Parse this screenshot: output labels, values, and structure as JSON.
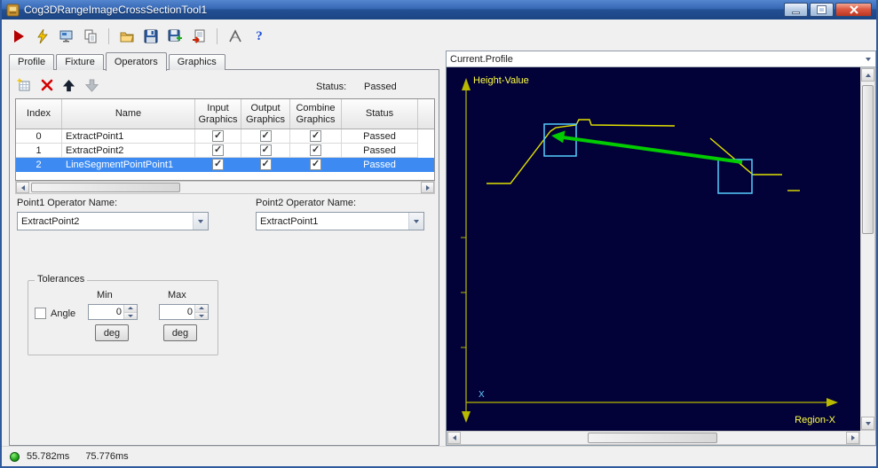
{
  "window": {
    "title": "Cog3DRangeImageCrossSectionTool1"
  },
  "tabs": [
    {
      "label": "Profile"
    },
    {
      "label": "Fixture"
    },
    {
      "label": "Operators"
    },
    {
      "label": "Graphics"
    }
  ],
  "operators": {
    "status_label": "Status:",
    "status_value": "Passed",
    "table": {
      "columns": [
        "Index",
        "Name",
        "Input Graphics",
        "Output Graphics",
        "Combine Graphics",
        "Status"
      ],
      "rows": [
        {
          "index": "0",
          "name": "ExtractPoint1",
          "input_graphics": true,
          "output_graphics": true,
          "combine_graphics": true,
          "status": "Passed",
          "selected": false
        },
        {
          "index": "1",
          "name": "ExtractPoint2",
          "input_graphics": true,
          "output_graphics": true,
          "combine_graphics": true,
          "status": "Passed",
          "selected": false
        },
        {
          "index": "2",
          "name": "LineSegmentPointPoint1",
          "input_graphics": true,
          "output_graphics": true,
          "combine_graphics": true,
          "status": "Passed",
          "selected": true
        }
      ]
    },
    "point1_label": "Point1 Operator Name:",
    "point1_value": "ExtractPoint2",
    "point2_label": "Point2 Operator Name:",
    "point2_value": "ExtractPoint1",
    "tolerances": {
      "group_label": "Tolerances",
      "min_label": "Min",
      "max_label": "Max",
      "angle_label": "Angle",
      "angle_checked": false,
      "min_value": "0",
      "max_value": "0",
      "min_unit_button": "deg",
      "max_unit_button": "deg"
    }
  },
  "graphics": {
    "record_selector": "Current.Profile",
    "y_axis_label": "Height-Value",
    "x_axis_label": "Region-X",
    "origin_axis_label": "X"
  },
  "statusbar": {
    "run_time": "55.782ms",
    "total_time": "75.776ms"
  },
  "icons": {
    "help": "?"
  }
}
